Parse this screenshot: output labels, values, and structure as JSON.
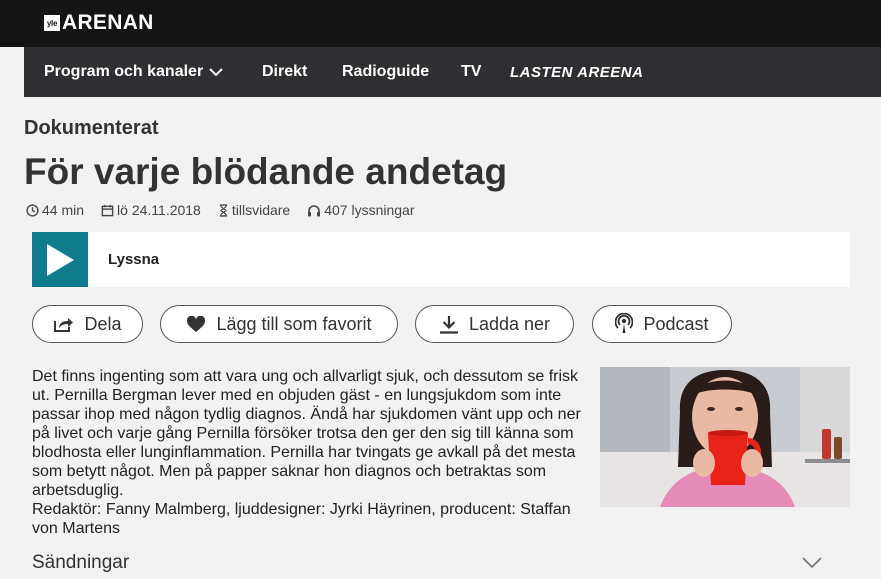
{
  "header": {
    "logo_badge": "yle",
    "logo_text": "ARENAN"
  },
  "nav": {
    "items": [
      "Program och kanaler",
      "Direkt",
      "Radioguide",
      "TV"
    ],
    "lasten": "LASTEN AREENA"
  },
  "program": {
    "category": "Dokumenterat",
    "title": "För varje blödande andetag",
    "duration": "44 min",
    "date": "lö 24.11.2018",
    "availability": "tillsvidare",
    "listens": "407 lyssningar"
  },
  "player": {
    "label": "Lyssna",
    "accent": "#0e7c8e"
  },
  "actions": {
    "share": "Dela",
    "favorite": "Lägg till som favorit",
    "download": "Ladda ner",
    "podcast": "Podcast"
  },
  "description": {
    "body": "Det finns ingenting som att vara ung och allvarligt sjuk, och dessutom se frisk ut. Pernilla Bergman lever med en objuden gäst - en lungsjukdom som inte passar ihop med någon tydlig diagnos. Ändå har sjukdomen vänt upp och ner på livet och varje gång Pernilla försöker trotsa den ger den sig till känna som blodhosta eller lunginflammation. Pernilla har tvingats ge avkall på det mesta som betytt något. Men på papper saknar hon diagnos och betraktas som arbetsduglig.",
    "credits": "Redaktör: Fanny Malmberg, ljuddesigner: Jyrki Häyrinen, producent: Staffan von Martens"
  },
  "broadcasts": {
    "label": "Sändningar"
  }
}
